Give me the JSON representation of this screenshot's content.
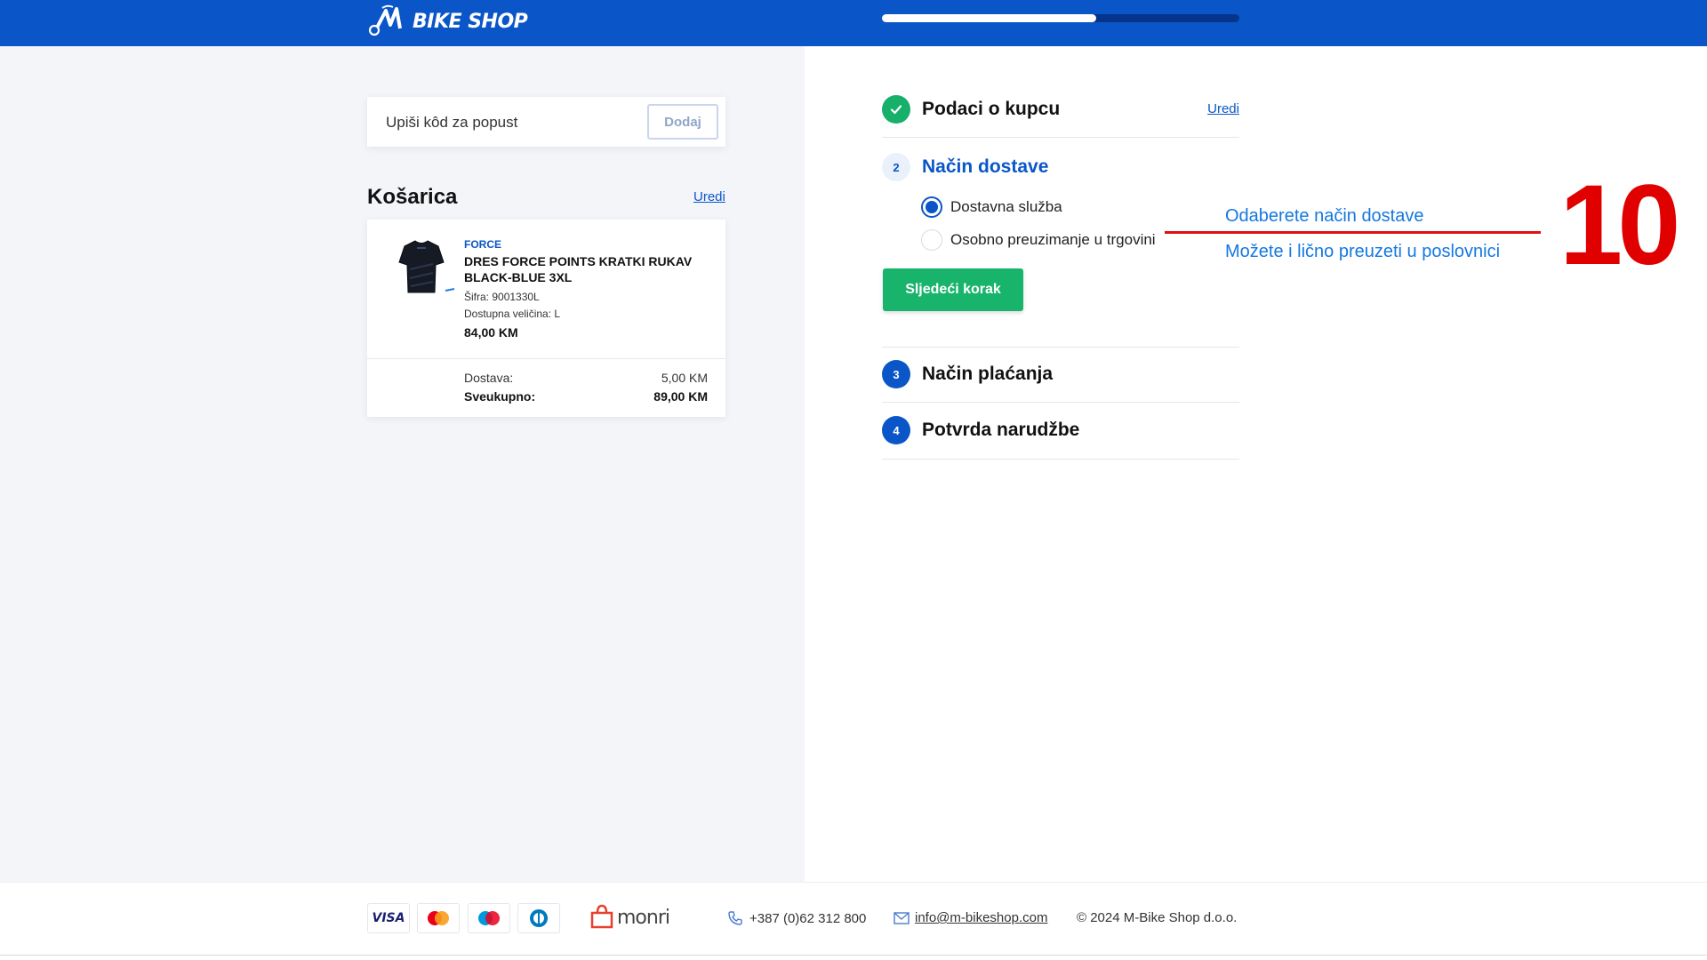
{
  "header": {
    "logo_text": "BIKE SHOP",
    "progress_fraction": 0.6
  },
  "coupon": {
    "placeholder": "Upiši kôd za popust",
    "button_label": "Dodaj"
  },
  "cart": {
    "title": "Košarica",
    "edit_label": "Uredi",
    "item": {
      "brand": "FORCE",
      "name": "DRES FORCE POINTS KRATKI RUKAV BLACK-BLUE 3XL",
      "sku": "Šifra: 9001330L",
      "size": "Dostupna veličina: L",
      "price": "84,00 KM"
    },
    "shipping_label": "Dostava:",
    "shipping_value": "5,00 KM",
    "total_label": "Sveukupno:",
    "total_value": "89,00 KM"
  },
  "checkout": {
    "step1": {
      "title": "Podaci o kupcu",
      "edit_label": "Uredi",
      "status": "done"
    },
    "step2": {
      "number": "2",
      "title": "Način dostave",
      "options": [
        {
          "label": "Dostavna služba",
          "checked": true
        },
        {
          "label": "Osobno preuzimanje u trgovini",
          "checked": false
        }
      ],
      "next_label": "Sljedeći korak"
    },
    "step3": {
      "number": "3",
      "title": "Način plaćanja"
    },
    "step4": {
      "number": "4",
      "title": "Potvrda narudžbe"
    }
  },
  "annotation": {
    "line1": "Odaberete način dostave",
    "line2": "Možete i lično preuzeti u poslovnici",
    "number": "10",
    "color": "#e00000"
  },
  "footer": {
    "payment_icons": [
      "visa-icon",
      "mastercard-icon",
      "maestro-icon",
      "diners-icon"
    ],
    "visa_text": "VISA",
    "monri_text": "monri",
    "phone": "+387 (0)62 312 800",
    "email": "info@m-bikeshop.com",
    "copyright": "© 2024 M-Bike Shop d.o.o."
  },
  "colors": {
    "brand_blue": "#0a56c8",
    "green": "#19b46c",
    "annotation_red": "#e00000"
  }
}
